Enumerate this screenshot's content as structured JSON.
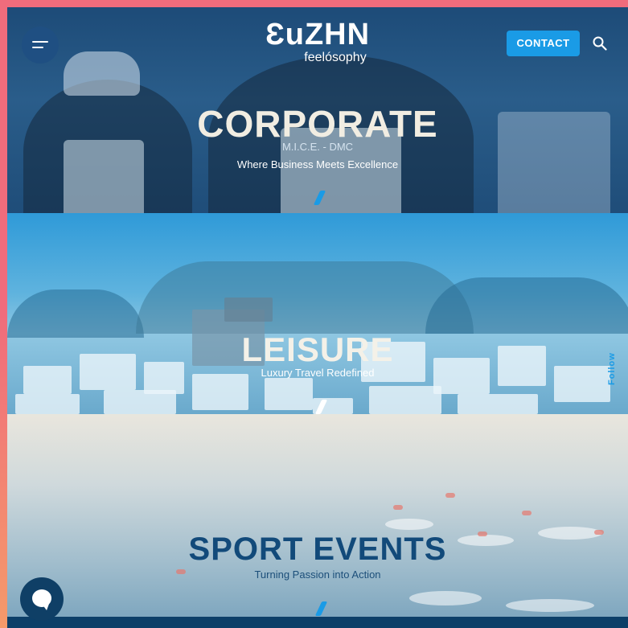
{
  "header": {
    "logo_main": "ƐuZHN",
    "logo_sub": "feelósophy",
    "contact_label": "CONTACT"
  },
  "sections": {
    "corporate": {
      "title": "CORPORATE",
      "tagline": "M.I.C.E. - DMC",
      "subtitle": "Where Business Meets Excellence"
    },
    "leisure": {
      "title": "LEISURE",
      "subtitle": "Luxury Travel Redefined"
    },
    "sport": {
      "title": "SPORT EVENTS",
      "subtitle": "Turning Passion into Action"
    }
  },
  "side": {
    "follow_label": "Follow"
  },
  "colors": {
    "accent": "#1a9be6",
    "navy": "#0c4a78",
    "frame": "#f06c7c"
  },
  "icons": {
    "menu": "hamburger-icon",
    "search": "search-icon",
    "chat": "chat-icon"
  }
}
